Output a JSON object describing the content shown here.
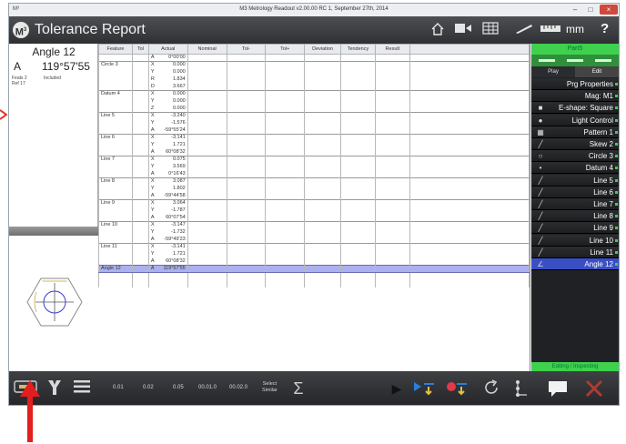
{
  "window": {
    "app_icon_text": "M³",
    "title": "M3 Metrology Readout  v2.00.00 RC 1, September 27th, 2014",
    "minimize_glyph": "–",
    "maximize_glyph": "□",
    "close_glyph": "×"
  },
  "header": {
    "logo_text": "M",
    "logo_sup": "3",
    "page_title": "Tolerance Report",
    "icons": [
      "home-icon",
      "camera-icon",
      "grid-icon",
      "probe-icon",
      "ruler-icon"
    ],
    "units": "mm",
    "help": "?"
  },
  "left_panel": {
    "feature_name": "Angle 12",
    "axis_letter": "A",
    "axis_value": "119°57'55",
    "feats_label": "Feats 2",
    "feats_value": "Included",
    "ref_label": "Ref 17"
  },
  "table": {
    "columns": [
      "Feature",
      "Tol",
      "Actual",
      "Nominal",
      "Tol-",
      "Tol+",
      "Deviation",
      "Tendency",
      "Result"
    ],
    "rows": [
      {
        "feature": "",
        "axis": "A",
        "actual": "0°00'00",
        "group_start": false
      },
      {
        "feature": "Circle 3",
        "axis": "X",
        "actual": "0.000",
        "group_start": true
      },
      {
        "feature": "",
        "axis": "Y",
        "actual": "0.000",
        "group_start": false
      },
      {
        "feature": "",
        "axis": "R",
        "actual": "1.834",
        "group_start": false
      },
      {
        "feature": "",
        "axis": "D",
        "actual": "3.667",
        "group_start": false
      },
      {
        "feature": "Datum 4",
        "axis": "X",
        "actual": "0.000",
        "group_start": true
      },
      {
        "feature": "",
        "axis": "Y",
        "actual": "0.000",
        "group_start": false
      },
      {
        "feature": "",
        "axis": "Z",
        "actual": "0.000",
        "group_start": false
      },
      {
        "feature": "Line 5",
        "axis": "X",
        "actual": "-3.240",
        "group_start": true
      },
      {
        "feature": "",
        "axis": "Y",
        "actual": "-1.576",
        "group_start": false
      },
      {
        "feature": "",
        "axis": "A",
        "actual": "-59°55'24",
        "group_start": false
      },
      {
        "feature": "Line 6",
        "axis": "X",
        "actual": "-3.141",
        "group_start": true
      },
      {
        "feature": "",
        "axis": "Y",
        "actual": "1.721",
        "group_start": false
      },
      {
        "feature": "",
        "axis": "A",
        "actual": "60°08'32",
        "group_start": false
      },
      {
        "feature": "Line 7",
        "axis": "X",
        "actual": "0.075",
        "group_start": true
      },
      {
        "feature": "",
        "axis": "Y",
        "actual": "3.569",
        "group_start": false
      },
      {
        "feature": "",
        "axis": "A",
        "actual": "0°16'43",
        "group_start": false
      },
      {
        "feature": "Line 8",
        "axis": "X",
        "actual": "3.087",
        "group_start": true
      },
      {
        "feature": "",
        "axis": "Y",
        "actual": "1.802",
        "group_start": false
      },
      {
        "feature": "",
        "axis": "A",
        "actual": "-59°44'58",
        "group_start": false
      },
      {
        "feature": "Line 9",
        "axis": "X",
        "actual": "3.064",
        "group_start": true
      },
      {
        "feature": "",
        "axis": "Y",
        "actual": "-1.787",
        "group_start": false
      },
      {
        "feature": "",
        "axis": "A",
        "actual": "60°07'54",
        "group_start": false
      },
      {
        "feature": "Line 10",
        "axis": "X",
        "actual": "-3.147",
        "group_start": true
      },
      {
        "feature": "",
        "axis": "Y",
        "actual": "-1.732",
        "group_start": false
      },
      {
        "feature": "",
        "axis": "A",
        "actual": "-59°49'23",
        "group_start": false
      },
      {
        "feature": "Line 11",
        "axis": "X",
        "actual": "-3.141",
        "group_start": true
      },
      {
        "feature": "",
        "axis": "Y",
        "actual": "1.721",
        "group_start": false
      },
      {
        "feature": "",
        "axis": "A",
        "actual": "60°08'32",
        "group_start": false
      },
      {
        "feature": "Angle 12",
        "axis": "A",
        "actual": "119°57'55",
        "group_start": true,
        "selected": true
      }
    ]
  },
  "right_panel": {
    "part_name": "Part5",
    "tab_play": "Play",
    "tab_edit": "Edit",
    "items": [
      {
        "label": "Prg Properties",
        "icon": "",
        "icon_name": "none"
      },
      {
        "label": "Mag: M1",
        "icon": "",
        "icon_name": "none"
      },
      {
        "label": "E-shape: Square",
        "icon": "■",
        "icon_name": "square-icon"
      },
      {
        "label": "Light Control",
        "icon": "●",
        "icon_name": "light-bulb-icon"
      },
      {
        "label": "Pattern 1",
        "icon": "▦",
        "icon_name": "pattern-icon"
      },
      {
        "label": "Skew 2",
        "icon": "╱",
        "icon_name": "skew-icon"
      },
      {
        "label": "Circle 3",
        "icon": "○",
        "icon_name": "circle-icon"
      },
      {
        "label": "Datum 4",
        "icon": "•",
        "icon_name": "datum-icon"
      },
      {
        "label": "Line 5",
        "icon": "╱",
        "icon_name": "line-icon"
      },
      {
        "label": "Line 6",
        "icon": "╱",
        "icon_name": "line-icon"
      },
      {
        "label": "Line 7",
        "icon": "╱",
        "icon_name": "line-icon"
      },
      {
        "label": "Line 8",
        "icon": "╱",
        "icon_name": "line-icon"
      },
      {
        "label": "Line 9",
        "icon": "╱",
        "icon_name": "line-icon"
      },
      {
        "label": "Line 10",
        "icon": "╱",
        "icon_name": "line-icon"
      },
      {
        "label": "Line 11",
        "icon": "╱",
        "icon_name": "line-icon"
      },
      {
        "label": "Angle 12",
        "icon": "∠",
        "icon_name": "angle-icon",
        "active": true
      }
    ],
    "status": "Editing / Inspecting"
  },
  "bottom_bar": {
    "resolutions": [
      "0.01",
      "0.02",
      "0.05",
      "00.01.0",
      "00.02.0"
    ],
    "select_similar_line1": "Select",
    "select_similar_line2": "Similar",
    "sum_glyph": "Σ",
    "play_glyph": "▶",
    "left_icons": [
      "keyboard-icon",
      "measure-tool-icon",
      "menu-icon"
    ],
    "right_icons": [
      "play-icon",
      "send-to-report-icon",
      "record-icon",
      "repeat-icon",
      "steps-icon",
      "comment-icon",
      "delete-icon"
    ]
  },
  "colors": {
    "accent_green": "#3fd14d",
    "selection_blue": "#3b4fc5",
    "row_highlight": "#aab1ee",
    "annotation_red": "#e03a2a"
  }
}
